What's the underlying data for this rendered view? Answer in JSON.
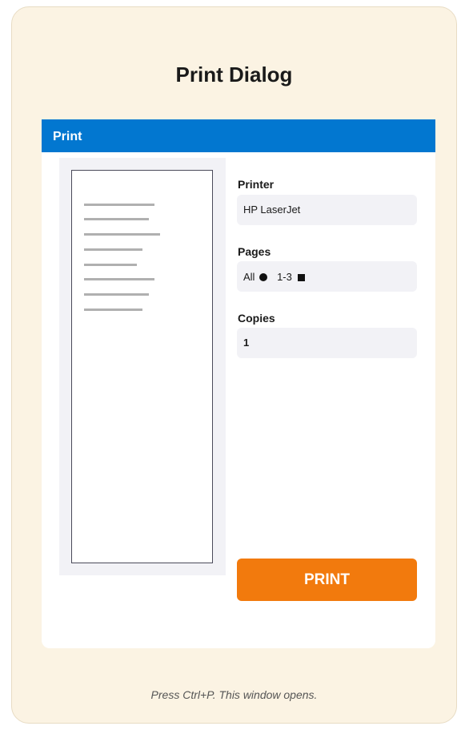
{
  "heading": "Print Dialog",
  "window": {
    "title": "Print",
    "title_bar_color": "#0277d0"
  },
  "preview": {
    "text_line_count": 8
  },
  "printer": {
    "label": "Printer",
    "value": "HP LaserJet"
  },
  "pages": {
    "label": "Pages",
    "options": [
      {
        "label": "All",
        "icon": "filled-circle-icon"
      },
      {
        "label": "1-3",
        "icon": "filled-square-icon"
      }
    ]
  },
  "copies": {
    "label": "Copies",
    "value": "1"
  },
  "print_button": {
    "label": "PRINT",
    "color": "#f27a0d"
  },
  "footer_caption": "Press Ctrl+P. This window opens."
}
